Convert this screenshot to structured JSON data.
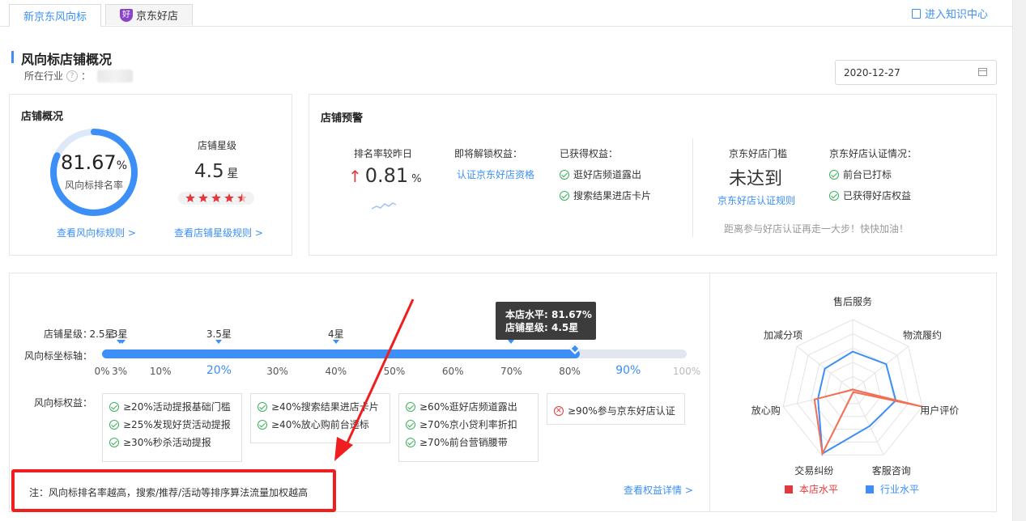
{
  "tabs": [
    {
      "label": "新京东风向标",
      "active": true
    },
    {
      "label": "京东好店",
      "active": false,
      "badge": "好"
    }
  ],
  "header_link": "进入知识中心",
  "page": {
    "title": "风向标店铺概况",
    "industry_label": "所在行业",
    "industry_colon": "：",
    "date": "2020-12-27"
  },
  "overview": {
    "title": "店铺概况",
    "ring_value": "81.67",
    "ring_unit": "%",
    "ring_fraction": 0.8167,
    "ring_label": "风向标排名率",
    "star_title": "店铺星级",
    "star_value": "4.5",
    "star_unit": "星",
    "star_rating": 4.5,
    "rule_link": "查看风向标规则 >",
    "star_link": "查看店铺星级规则 >"
  },
  "warning": {
    "title": "店铺预警",
    "rank_label": "排名率较昨日",
    "rank_value": "0.81",
    "rank_unit": "%",
    "unlock_label": "即将解锁权益：",
    "unlock_link": "认证京东好店资格",
    "gained_label": "已获得权益：",
    "gained_items": [
      "逛好店频道露出",
      "搜索结果进店卡片"
    ],
    "threshold_label": "京东好店门槛",
    "threshold_value": "未达到",
    "threshold_link": "京东好店认证规则",
    "cert_label": "京东好店认证情况：",
    "cert_items": [
      "前台已打标",
      "已获得好店权益"
    ],
    "encourage": "距离参与好店认证再走一大步！快快加油！"
  },
  "axis": {
    "star_label": "店铺星级：",
    "axis_label": "风向标坐标轴：",
    "star_ticks": [
      {
        "label": "2.5星",
        "pct": 0
      },
      {
        "label": "3星",
        "pct": 3
      },
      {
        "label": "3.5星",
        "pct": 20
      },
      {
        "label": "4星",
        "pct": 40
      },
      {
        "label": "4.5星",
        "pct": 70
      }
    ],
    "pct_ticks": [
      "0%",
      "3%",
      "10%",
      "20%",
      "30%",
      "40%",
      "50%",
      "60%",
      "70%",
      "80%",
      "90%",
      "100%"
    ],
    "pct_values": [
      0,
      3,
      10,
      20,
      30,
      40,
      50,
      60,
      70,
      80,
      90,
      100
    ],
    "fill_fraction": 0.8167,
    "tooltip_line1": "本店水平: 81.67%",
    "tooltip_line2": "店铺星级: 4.5星"
  },
  "benefits": {
    "label": "风向标权益：",
    "groups": [
      {
        "items": [
          "≥20%活动提报基础门槛",
          "≥25%发现好货活动提报",
          "≥30%秒杀活动提报"
        ],
        "achieved": true
      },
      {
        "items": [
          "≥40%搜索结果进店卡片",
          "≥40%放心购前台透标"
        ],
        "achieved": true
      },
      {
        "items": [
          "≥60%逛好店频道露出",
          "≥70%京小贷利率折扣",
          "≥70%前台营销腰带"
        ],
        "achieved": true
      },
      {
        "items": [
          "≥90%参与京东好店认证"
        ],
        "achieved": false
      }
    ],
    "note": "注：风向标排名率越高，搜索/推荐/活动等排序算法流量加权越高",
    "detail_link": "查看权益详情 >"
  },
  "radar": {
    "axes": [
      "售后服务",
      "物流履约",
      "用户评价",
      "客服咨询",
      "交易纠纷",
      "放心购",
      "加减分项"
    ],
    "legend_store": "本店水平",
    "legend_industry": "行业水平",
    "colors": {
      "store": "#f36f54",
      "industry": "#3b8ff6"
    },
    "store_values": [
      0.02,
      0.02,
      1.0,
      0.02,
      0.98,
      0.55,
      0.02
    ],
    "industry_values": [
      0.55,
      0.6,
      0.62,
      0.55,
      0.98,
      0.5,
      0.5
    ]
  }
}
